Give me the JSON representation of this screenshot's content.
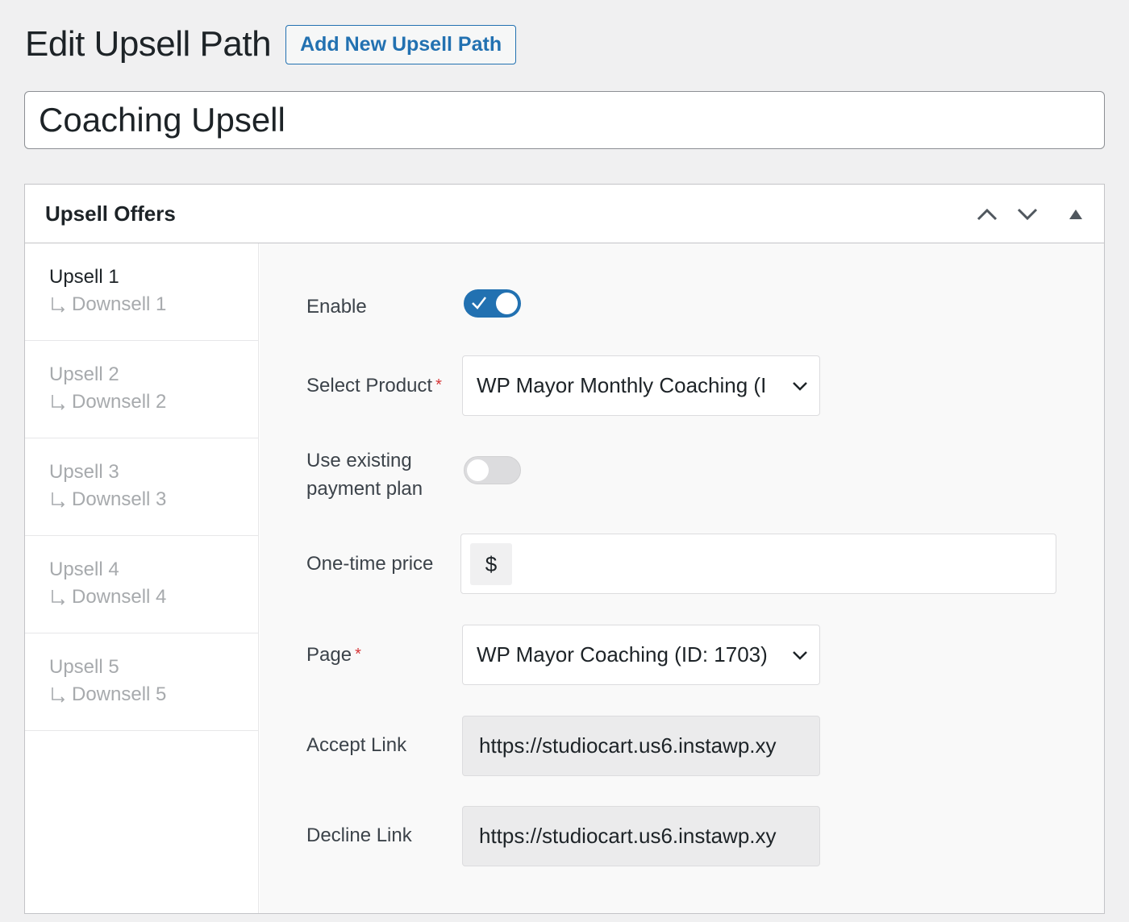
{
  "header": {
    "title": "Edit Upsell Path",
    "add_new_label": "Add New Upsell Path"
  },
  "path_title": {
    "value": "Coaching Upsell"
  },
  "metabox": {
    "title": "Upsell Offers",
    "controls": [
      "move-up",
      "move-down",
      "toggle-panel"
    ]
  },
  "sidebar": {
    "items": [
      {
        "upsell": "Upsell 1",
        "downsell": "Downsell 1",
        "active": true
      },
      {
        "upsell": "Upsell 2",
        "downsell": "Downsell 2",
        "active": false
      },
      {
        "upsell": "Upsell 3",
        "downsell": "Downsell 3",
        "active": false
      },
      {
        "upsell": "Upsell 4",
        "downsell": "Downsell 4",
        "active": false
      },
      {
        "upsell": "Upsell 5",
        "downsell": "Downsell 5",
        "active": false
      }
    ]
  },
  "form": {
    "enable": {
      "label": "Enable",
      "checked": true
    },
    "product": {
      "label": "Select Product",
      "required_mark": "*",
      "value": "WP Mayor Monthly Coaching (I"
    },
    "existing_plan": {
      "label_line1": "Use existing",
      "label_line2": "payment plan",
      "checked": false
    },
    "price": {
      "label": "One-time price",
      "currency": "$",
      "value": ""
    },
    "page": {
      "label": "Page",
      "required_mark": "*",
      "value": "WP Mayor Coaching (ID: 1703)"
    },
    "accept_link": {
      "label": "Accept Link",
      "value": "https://studiocart.us6.instawp.xy"
    },
    "decline_link": {
      "label": "Decline Link",
      "value": "https://studiocart.us6.instawp.xy"
    }
  },
  "colors": {
    "accent": "#2271b1",
    "required": "#d63638",
    "background": "#f0f0f1"
  }
}
